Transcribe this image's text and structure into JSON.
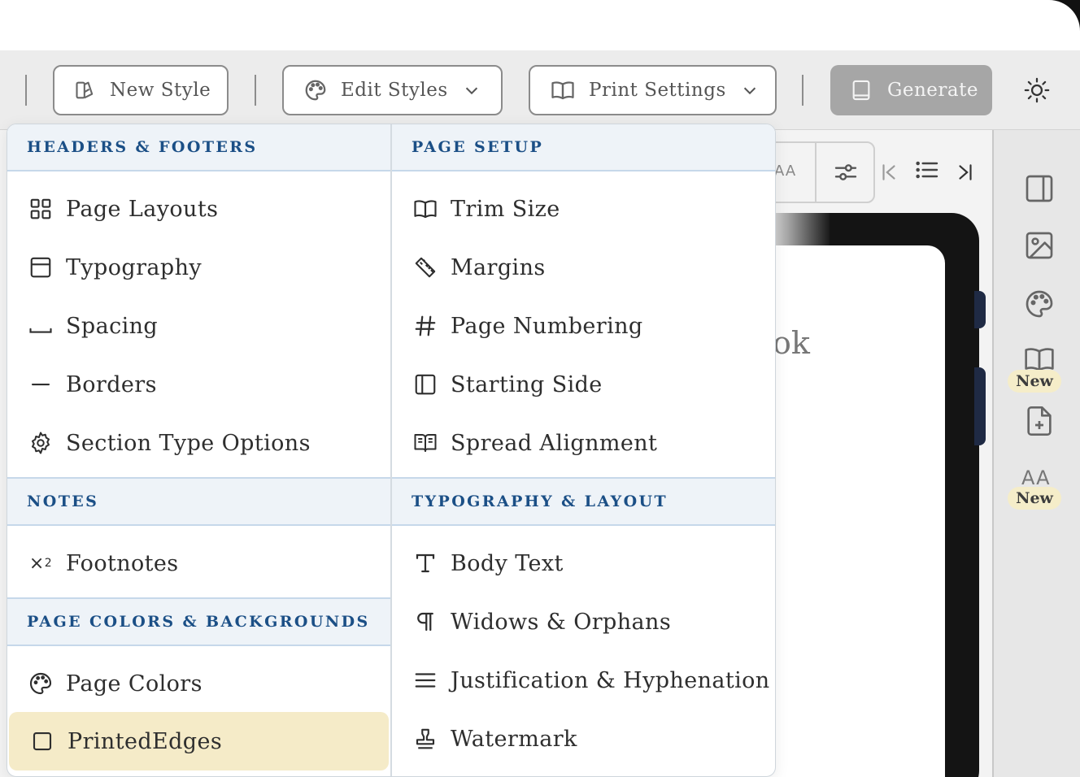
{
  "toolbar": {
    "new_style_label": "New Style",
    "edit_styles_label": "Edit Styles",
    "print_settings_label": "Print Settings",
    "generate_label": "Generate"
  },
  "rail": {
    "badges": [
      "New",
      "New"
    ]
  },
  "document": {
    "partial_text": "ok"
  },
  "menu": {
    "left": {
      "headers_footers": {
        "title": "HEADERS & FOOTERS",
        "items": [
          "Page Layouts",
          "Typography",
          "Spacing",
          "Borders",
          "Section Type Options"
        ]
      },
      "notes": {
        "title": "NOTES",
        "items": [
          "Footnotes"
        ]
      },
      "page_colors": {
        "title": "PAGE COLORS & BACKGROUNDS",
        "items": [
          "Page Colors",
          "PrintedEdges"
        ]
      }
    },
    "right": {
      "page_setup": {
        "title": "PAGE SETUP",
        "items": [
          "Trim Size",
          "Margins",
          "Page Numbering",
          "Starting Side",
          "Spread Alignment"
        ]
      },
      "typography_layout": {
        "title": "TYPOGRAPHY & LAYOUT",
        "items": [
          "Body Text",
          "Widows & Orphans",
          "Justification & Hyphenation",
          "Watermark"
        ]
      }
    },
    "active_item": "PrintedEdges"
  },
  "colors": {
    "section_title": "#1b4f86",
    "section_bg": "#eef3f8",
    "active_bg": "#f5ebc8",
    "generate_bg": "#a6a6a6",
    "badge_bg": "#f5edc9"
  }
}
